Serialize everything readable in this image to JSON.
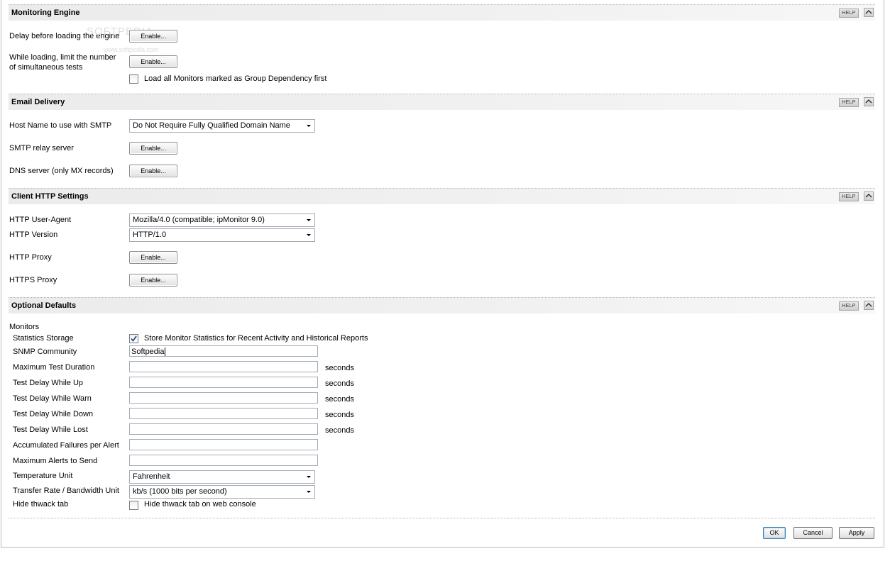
{
  "watermark": {
    "main": "SOFTPEDIA",
    "sub": "www.softpedia.com"
  },
  "icons": {
    "help": "help-button",
    "collapse": "chevron-up-icon",
    "dropdown": "chevron-down-icon",
    "check": "checkmark-icon"
  },
  "monitoring_engine": {
    "title": "Monitoring Engine",
    "help": "HELP",
    "delay_label": "Delay before loading the engine",
    "delay_button": "Enable...",
    "limit_label": "While loading, limit the number of simultaneous tests",
    "limit_button": "Enable...",
    "group_dep_label": "Load all Monitors marked as Group Dependency first",
    "group_dep_checked": false
  },
  "email_delivery": {
    "title": "Email Delivery",
    "help": "HELP",
    "host_label": "Host Name to use with SMTP",
    "host_value": "Do Not Require Fully Qualified Domain Name",
    "relay_label": "SMTP relay server",
    "relay_button": "Enable...",
    "dns_label": "DNS server (only MX records)",
    "dns_button": "Enable..."
  },
  "client_http": {
    "title": "Client HTTP Settings",
    "help": "HELP",
    "agent_label": "HTTP User-Agent",
    "agent_value": "Mozilla/4.0 (compatible; ipMonitor 9.0)",
    "version_label": "HTTP Version",
    "version_value": "HTTP/1.0",
    "proxy_label": "HTTP Proxy",
    "proxy_button": "Enable...",
    "https_label": "HTTPS Proxy",
    "https_button": "Enable..."
  },
  "optional_defaults": {
    "title": "Optional Defaults",
    "help": "HELP",
    "monitors_heading": "Monitors",
    "stats_label": "Statistics Storage",
    "stats_checkbox_label": "Store Monitor Statistics for Recent Activity and Historical Reports",
    "stats_checked": true,
    "snmp_label": "SNMP Community",
    "snmp_value": "Softpedia",
    "max_test_label": "Maximum Test Duration",
    "delay_up_label": "Test Delay While Up",
    "delay_warn_label": "Test Delay While Warn",
    "delay_down_label": "Test Delay While Down",
    "delay_lost_label": "Test Delay While Lost",
    "seconds": "seconds",
    "accum_label": "Accumulated Failures per Alert",
    "max_alerts_label": "Maximum Alerts to Send",
    "temp_label": "Temperature Unit",
    "temp_value": "Fahrenheit",
    "rate_label": "Transfer Rate / Bandwidth Unit",
    "rate_value": "kb/s (1000 bits per second)",
    "thwack_label": "Hide thwack tab",
    "thwack_checkbox_label": "Hide thwack tab on web console",
    "thwack_checked": false
  },
  "footer": {
    "ok": "OK",
    "cancel": "Cancel",
    "apply": "Apply"
  }
}
